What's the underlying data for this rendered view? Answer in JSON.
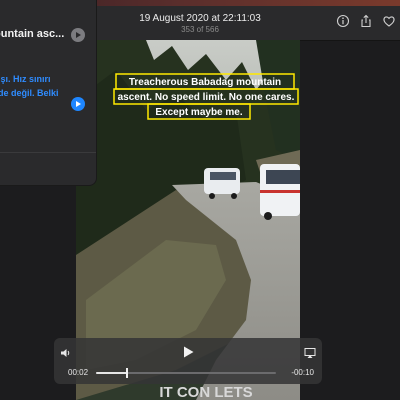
{
  "window": {
    "title_date": "19 August 2020 at 22:11:03",
    "photo_position": "353 of 566"
  },
  "toolbar": {
    "icons": [
      "info-icon",
      "share-icon",
      "heart-icon"
    ]
  },
  "sidebar": {
    "title": "ountain asc...",
    "message_text": "ışı. Hız sınırı\nde değil. Belki",
    "icons": [
      "play-circle-icon",
      "reply-arrow-icon"
    ]
  },
  "video": {
    "caption_lines": [
      "Treacherous Babadag mountain",
      "ascent. No speed limit. No one cares.",
      "Except maybe me."
    ],
    "bottom_overlay_text": "IT CON LETS",
    "current_time": "00:02",
    "remaining_time": "-00:10",
    "progress_fraction": 0.17
  },
  "colors": {
    "accent_blue": "#1e86ff",
    "caption_box": "#ffe900",
    "panel_bg": "#2a2a2c"
  }
}
